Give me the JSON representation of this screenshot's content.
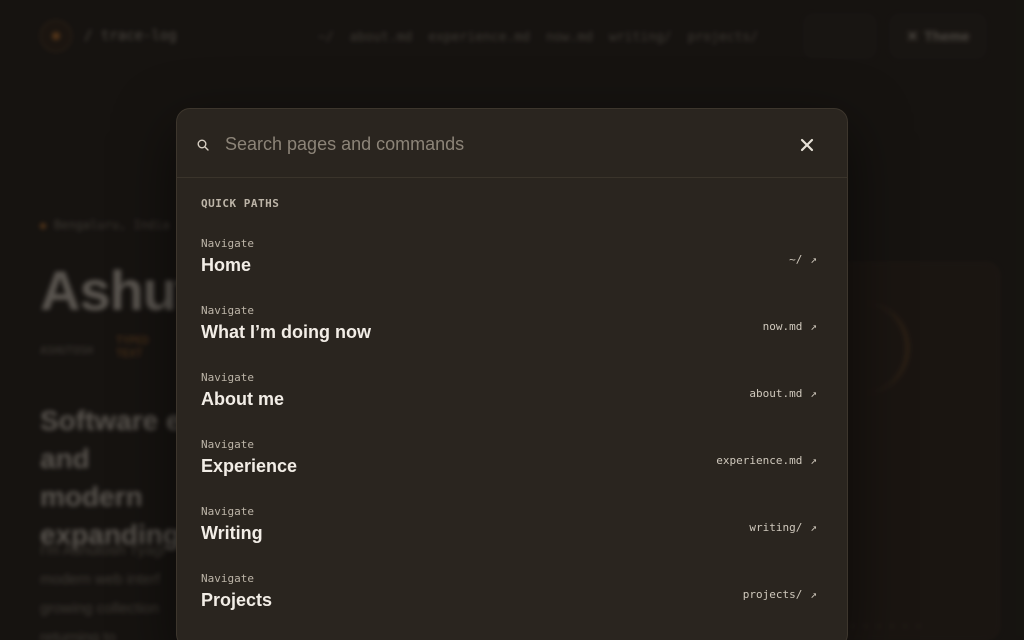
{
  "background": {
    "brand": "/ trace-log",
    "nav": [
      "~/",
      "about.md",
      "experience.md",
      "now.md",
      "writing/",
      "projects/"
    ],
    "theme_label": "Theme",
    "tag": "Bengaluru, India",
    "name": "Ashut",
    "sub": "ASHUTOSH",
    "orange": "TYPED TEXT",
    "lede": "Software e and modern expanding",
    "para": "I'm Ashutosh Tyagi modern web interf growing collection returning to",
    "card_foot": "· · ·  ·  ·  ·"
  },
  "palette": {
    "search_placeholder": "Search pages and commands",
    "search_value": "",
    "section_label": "QUICK PATHS",
    "items": [
      {
        "kicker": "Navigate",
        "title": "Home",
        "path": "~/"
      },
      {
        "kicker": "Navigate",
        "title": "What I’m doing now",
        "path": "now.md"
      },
      {
        "kicker": "Navigate",
        "title": "About me",
        "path": "about.md"
      },
      {
        "kicker": "Navigate",
        "title": "Experience",
        "path": "experience.md"
      },
      {
        "kicker": "Navigate",
        "title": "Writing",
        "path": "writing/"
      },
      {
        "kicker": "Navigate",
        "title": "Projects",
        "path": "projects/"
      }
    ],
    "arrow_glyph": "↗"
  },
  "colors": {
    "background": "#1c1915",
    "panel": "#2a251f",
    "accent": "#c8782e",
    "text": "#f2ede6"
  },
  "icons": {
    "search": "search-icon",
    "close": "close-icon",
    "arrow": "arrow-up-right-icon"
  }
}
